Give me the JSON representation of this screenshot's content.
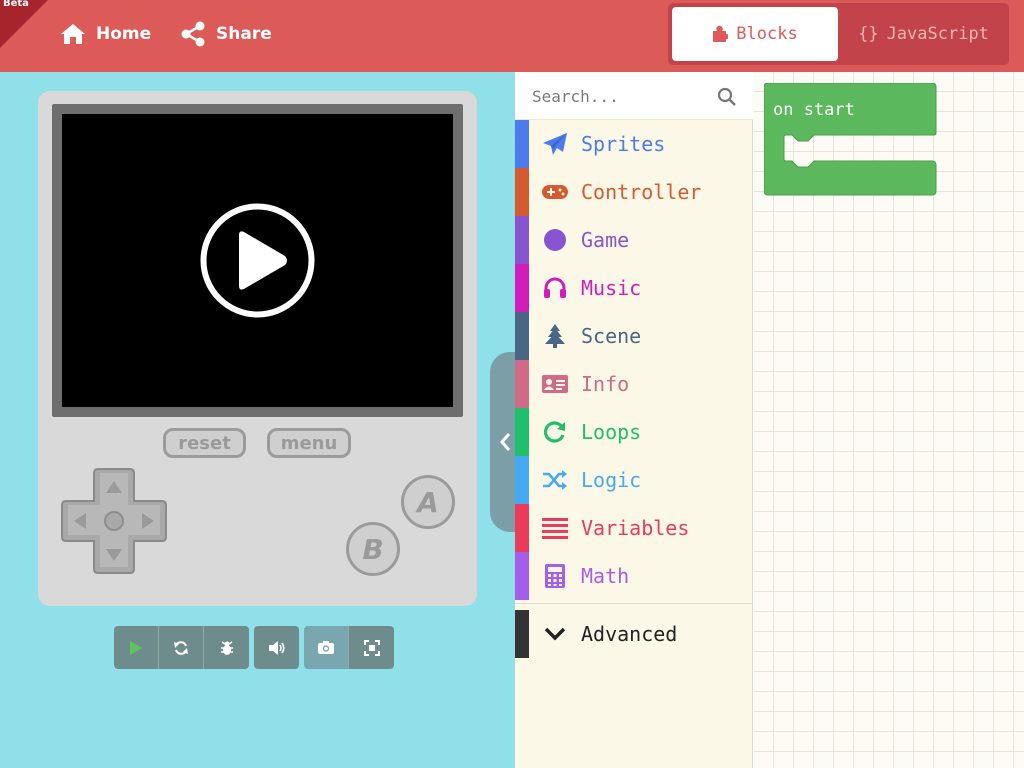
{
  "header": {
    "beta_label": "Beta",
    "home_label": "Home",
    "share_label": "Share",
    "editor_toggle": {
      "blocks_label": "Blocks",
      "javascript_label": "JavaScript",
      "javascript_prefix": "{}",
      "active": "Blocks"
    }
  },
  "simulator": {
    "reset_label": "reset",
    "menu_label": "menu",
    "a_label": "A",
    "b_label": "B",
    "toolbar": [
      "play-icon",
      "restart-icon",
      "debug-icon",
      "volume-icon",
      "camera-icon",
      "fullscreen-icon"
    ]
  },
  "toolbox": {
    "search_placeholder": "Search...",
    "categories": [
      {
        "label": "Sprites",
        "color": "#4B7BEC",
        "icon": "paper-plane-icon"
      },
      {
        "label": "Controller",
        "color": "#D65A31",
        "icon": "gamepad-icon"
      },
      {
        "label": "Game",
        "color": "#8854D0",
        "icon": "circle-icon"
      },
      {
        "label": "Music",
        "color": "#D11EB8",
        "icon": "headphones-icon"
      },
      {
        "label": "Scene",
        "color": "#4B6584",
        "icon": "tree-icon"
      },
      {
        "label": "Info",
        "color": "#CF6A87",
        "icon": "id-card-icon"
      },
      {
        "label": "Loops",
        "color": "#20BF6B",
        "icon": "refresh-icon"
      },
      {
        "label": "Logic",
        "color": "#45AAF2",
        "icon": "shuffle-icon"
      },
      {
        "label": "Variables",
        "color": "#EB3B5A",
        "icon": "list-icon"
      },
      {
        "label": "Math",
        "color": "#A55EEA",
        "icon": "calculator-icon"
      }
    ],
    "advanced": {
      "label": "Advanced",
      "color": "#222222",
      "icon": "chevron-down-icon"
    }
  },
  "workspace": {
    "blocks": [
      {
        "label": "on start",
        "color": "#5CB85C"
      }
    ]
  }
}
